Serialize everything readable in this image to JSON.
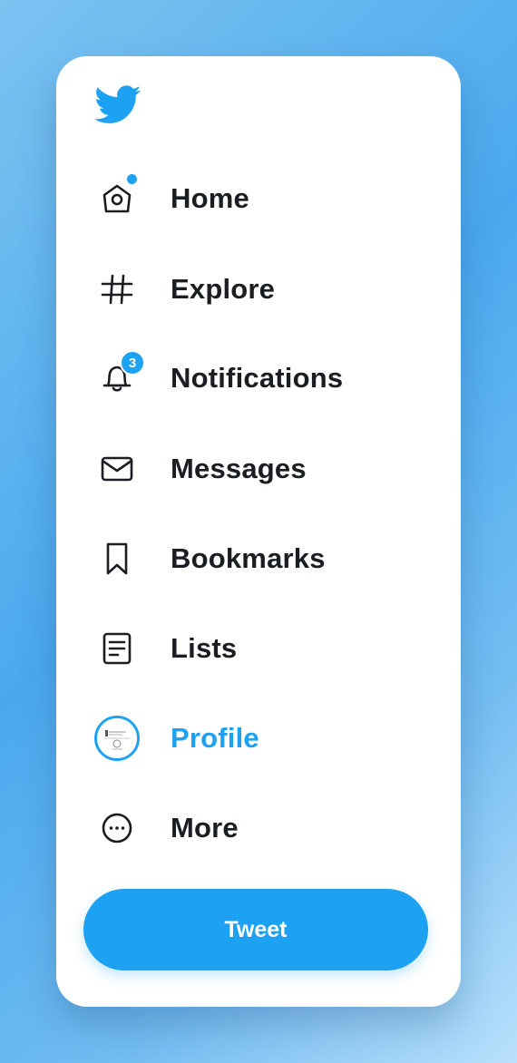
{
  "brand": {
    "logo_icon": "twitter-bird-icon",
    "color": "#1da1f2"
  },
  "nav": {
    "items": [
      {
        "label": "Home",
        "icon": "home-icon",
        "has_dot": true
      },
      {
        "label": "Explore",
        "icon": "hashtag-icon"
      },
      {
        "label": "Notifications",
        "icon": "bell-icon",
        "badge": "3"
      },
      {
        "label": "Messages",
        "icon": "envelope-icon"
      },
      {
        "label": "Bookmarks",
        "icon": "bookmark-icon"
      },
      {
        "label": "Lists",
        "icon": "list-icon"
      },
      {
        "label": "Profile",
        "icon": "avatar",
        "active": true
      },
      {
        "label": "More",
        "icon": "more-icon"
      }
    ]
  },
  "tweet_button": {
    "label": "Tweet"
  },
  "colors": {
    "accent": "#1da1f2",
    "text": "#1a1d21",
    "card_background": "#ffffff"
  }
}
